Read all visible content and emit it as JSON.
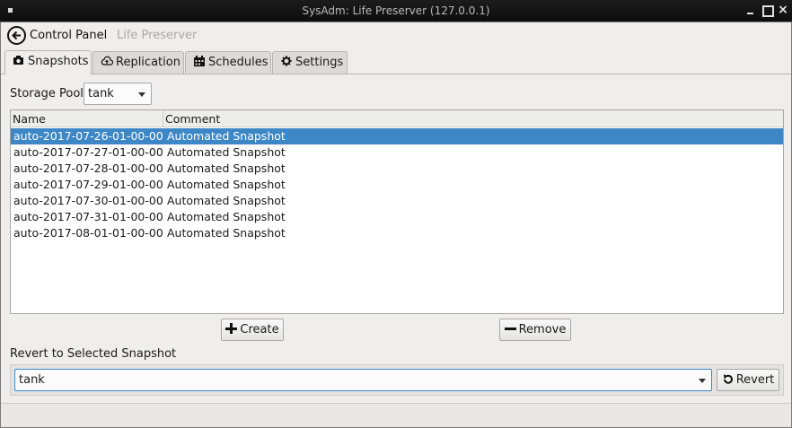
{
  "window": {
    "title": "SysAdm: Life Preserver (127.0.0.1)"
  },
  "nav": {
    "back_label": "Control Panel",
    "current": "Life Preserver"
  },
  "tabs": [
    {
      "label": "Snapshots",
      "icon": "camera-icon",
      "active": true
    },
    {
      "label": "Replication",
      "icon": "cloud-upload-icon",
      "active": false
    },
    {
      "label": "Schedules",
      "icon": "calendar-icon",
      "active": false
    },
    {
      "label": "Settings",
      "icon": "gear-icon",
      "active": false
    }
  ],
  "storage_pool": {
    "label": "Storage Pool",
    "value": "tank"
  },
  "snapshots": {
    "columns": [
      "Name",
      "Comment"
    ],
    "selected_index": 0,
    "rows": [
      {
        "name": "auto-2017-07-26-01-00-00",
        "comment": "Automated Snapshot"
      },
      {
        "name": "auto-2017-07-27-01-00-00",
        "comment": "Automated Snapshot"
      },
      {
        "name": "auto-2017-07-28-01-00-00",
        "comment": "Automated Snapshot"
      },
      {
        "name": "auto-2017-07-29-01-00-00",
        "comment": "Automated Snapshot"
      },
      {
        "name": "auto-2017-07-30-01-00-00",
        "comment": "Automated Snapshot"
      },
      {
        "name": "auto-2017-07-31-01-00-00",
        "comment": "Automated Snapshot"
      },
      {
        "name": "auto-2017-08-01-01-00-00",
        "comment": "Automated Snapshot"
      }
    ]
  },
  "actions": {
    "create_label": "Create",
    "remove_label": "Remove"
  },
  "revert": {
    "label": "Revert to Selected Snapshot",
    "value": "tank",
    "button_label": "Revert"
  },
  "colors": {
    "selection": "#3d87c6",
    "window_bg": "#efeeed",
    "titlebar_bg": "#111111"
  }
}
